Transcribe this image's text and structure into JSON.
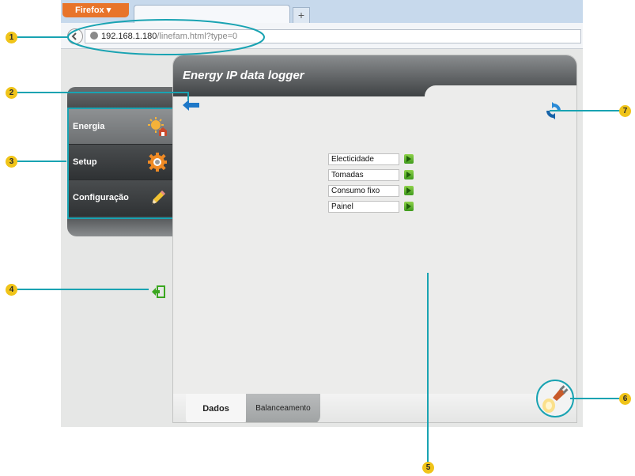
{
  "browser": {
    "menu_button": "Firefox",
    "new_tab_symbol": "+",
    "url_host": "192.168.1.180",
    "url_path": "/linefam.html?type=0"
  },
  "app": {
    "title": "Energy IP data logger"
  },
  "sidebar": {
    "items": [
      {
        "label": "Energia",
        "icon": "energy-house-icon",
        "active": true
      },
      {
        "label": "Setup",
        "icon": "gear-icon",
        "active": false
      },
      {
        "label": "Configuração",
        "icon": "pencil-icon",
        "active": false
      }
    ]
  },
  "list": [
    {
      "label": "Electicidade"
    },
    {
      "label": "Tomadas"
    },
    {
      "label": "Consumo fixo"
    },
    {
      "label": "Painel"
    }
  ],
  "tabs": [
    {
      "label": "Dados",
      "active": true
    },
    {
      "label": "Balanceamento",
      "active": false
    }
  ],
  "callouts": [
    "1",
    "2",
    "3",
    "4",
    "5",
    "6",
    "7"
  ],
  "colors": {
    "accent": "#19a3b2",
    "callout": "#f0c419",
    "firefox_orange": "#e8742a",
    "back_arrow_blue": "#1e78c8",
    "logout_green": "#3aa61f"
  }
}
